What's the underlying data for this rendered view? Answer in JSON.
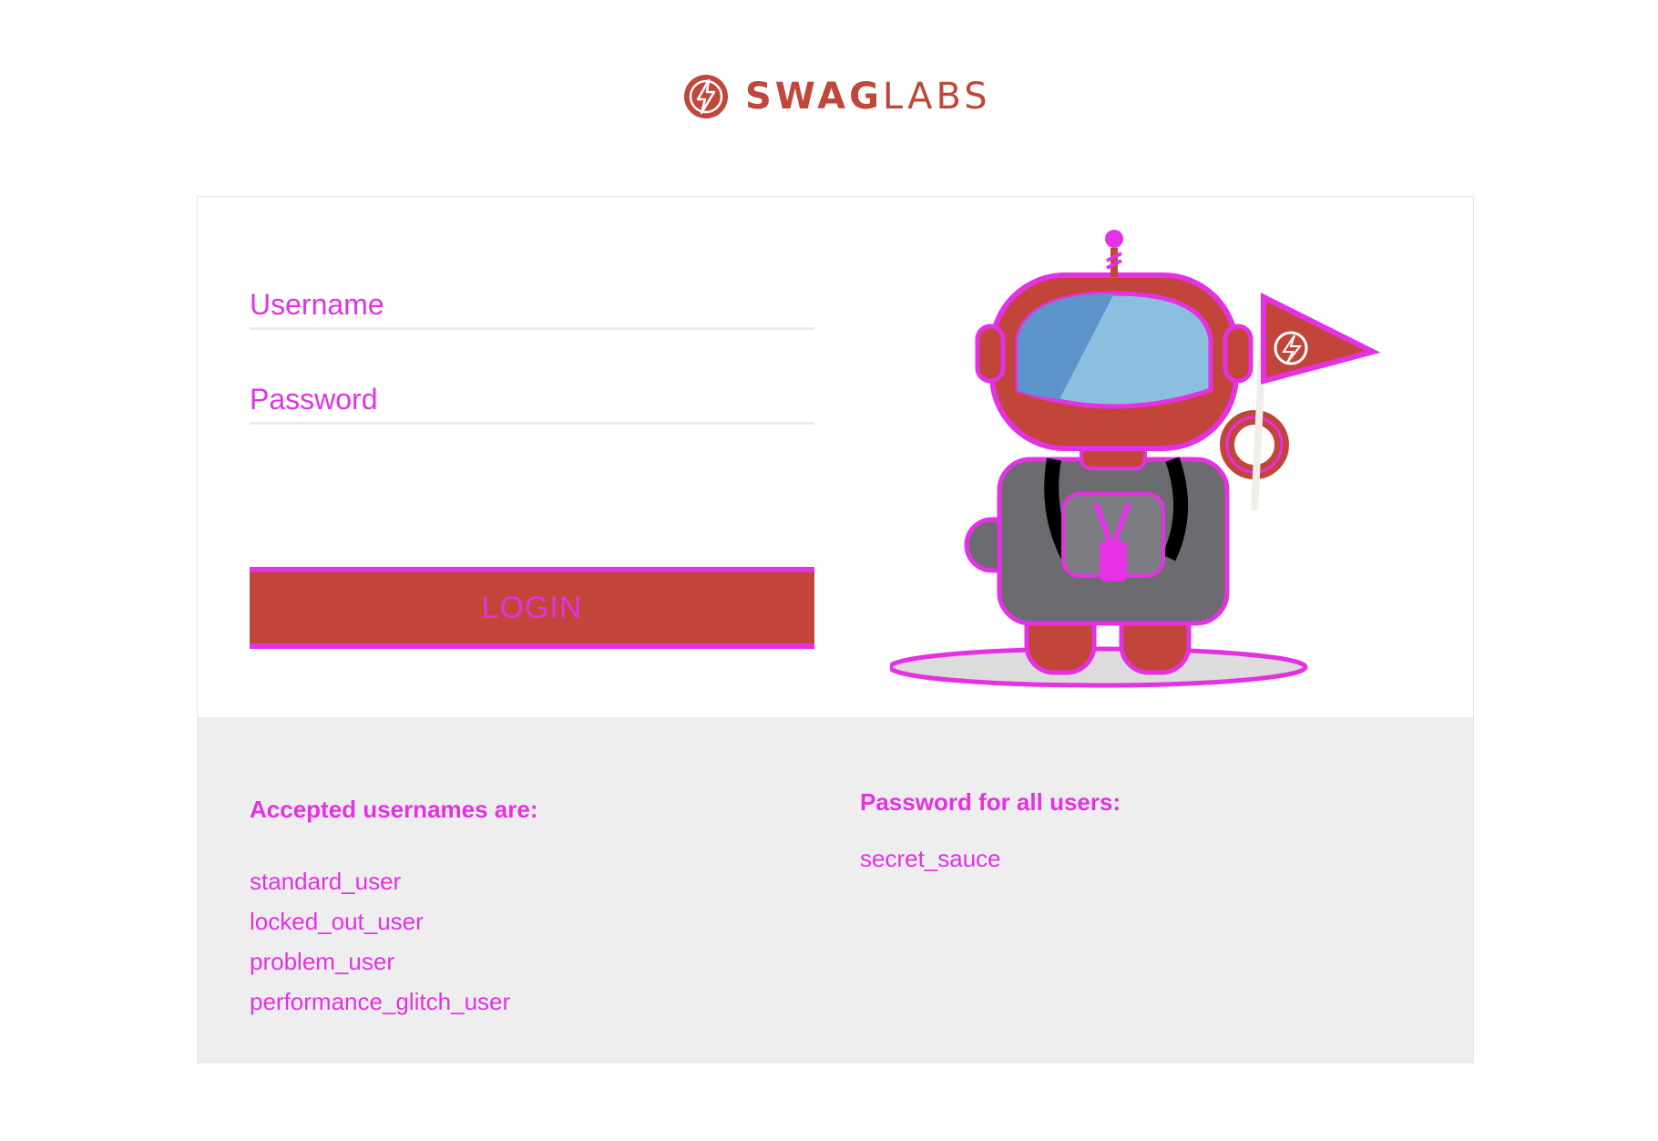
{
  "header": {
    "logo_icon": "lightning-bolt-icon",
    "logo_text_bold": "SWAG",
    "logo_text_light": "LABS"
  },
  "login": {
    "username_placeholder": "Username",
    "password_placeholder": "Password",
    "login_label": "LOGIN"
  },
  "mascot": {
    "icon": "robot-mascot-with-flag"
  },
  "credentials": {
    "usernames_title": "Accepted usernames are:",
    "usernames": [
      "standard_user",
      "locked_out_user",
      "problem_user",
      "performance_glitch_user"
    ],
    "password_title": "Password for all users:",
    "password_value": "secret_sauce"
  },
  "colors": {
    "brand": "#c2453a",
    "highlight": "#e331e3",
    "panel_bg": "#eeeeee",
    "visor": "#8bbfe0"
  }
}
